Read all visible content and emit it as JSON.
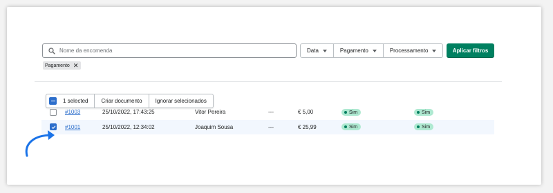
{
  "search": {
    "placeholder": "Nome da encomenda",
    "icon": "search-icon"
  },
  "filters": [
    {
      "label": "Data"
    },
    {
      "label": "Pagamento"
    },
    {
      "label": "Processamento"
    }
  ],
  "apply_button": {
    "label": "Aplicar filtros",
    "color": "#008060"
  },
  "active_tag": {
    "label": "Pagamento",
    "close": "✕"
  },
  "bulk_actions": {
    "selected_label": "1 selected",
    "create_document": "Criar documento",
    "ignore_selected": "Ignorar selecionados"
  },
  "rows": [
    {
      "order": "#1003",
      "date": "25/10/2022, 17:43:25",
      "client": "Vitor Pereira",
      "dash": "---",
      "total": "€ 5,00",
      "payment": "Sim",
      "processing": "Sim",
      "checked": false
    },
    {
      "order": "#1001",
      "date": "25/10/2022, 12:34:02",
      "client": "Joaquim Sousa",
      "dash": "---",
      "total": "€ 25,99",
      "payment": "Sim",
      "processing": "Sim",
      "checked": true
    }
  ],
  "colors": {
    "accent": "#2c6ecb",
    "success_badge": "#aee9d1",
    "primary": "#008060"
  }
}
